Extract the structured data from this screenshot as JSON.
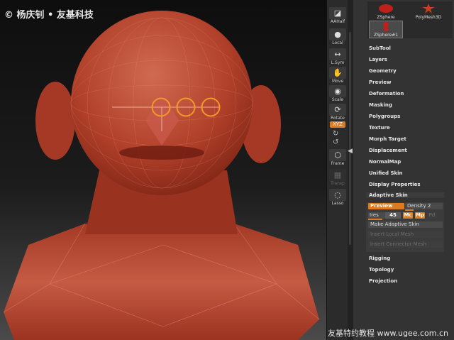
{
  "watermark_top": "© 杨庆钊 • 友基科技",
  "watermark_bottom": "友基特约教程 www.ugee.com.cn",
  "toolbar": {
    "aahalf": "AAHalf",
    "local": "Local",
    "lsym": "L.Sym",
    "move": "Move",
    "scale": "Scale",
    "rotate": "Rotate",
    "xyz": "XYZ",
    "frame": "Frame",
    "transp": "Transp",
    "lasso": "Lasso"
  },
  "thumbnails": [
    {
      "label": "ZSphere"
    },
    {
      "label": "PolyMesh3D"
    },
    {
      "label": "ZSphere#1"
    }
  ],
  "menu": [
    "SubTool",
    "Layers",
    "Geometry",
    "Preview",
    "Deformation",
    "Masking",
    "Polygroups",
    "Texture",
    "Morph Target",
    "Displacement",
    "NormalMap",
    "Unified Skin",
    "Display Properties",
    "Adaptive Skin"
  ],
  "adaptive_skin": {
    "preview": "Preview",
    "density": "Density 2",
    "ires_label": "Ires",
    "ires_value": "45",
    "ires_aux": "256",
    "mc": "Mc",
    "mp": "Mp",
    "pd": "Pd",
    "make": "Make Adaptive Skin",
    "insert_local": "Insert Local Mesh",
    "insert_connector": "Insert Connector Mesh"
  },
  "menu_after": [
    "Rigging",
    "Topology",
    "Projection"
  ],
  "colors": {
    "accent": "#e07a1e",
    "model": "#b8412a",
    "panel_bg": "#333333",
    "toolbar_bg": "#2b2b2b"
  }
}
